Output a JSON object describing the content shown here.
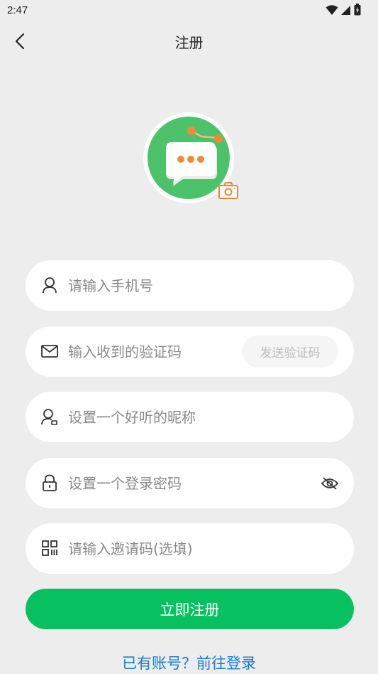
{
  "status_bar": {
    "time": "2:47"
  },
  "header": {
    "title": "注册"
  },
  "form": {
    "phone_placeholder": "请输入手机号",
    "code_placeholder": "输入收到的验证码",
    "send_code_label": "发送验证码",
    "nickname_placeholder": "设置一个好听的昵称",
    "password_placeholder": "设置一个登录密码",
    "invite_placeholder": "请输入邀请码(选填)",
    "submit_label": "立即注册"
  },
  "footer": {
    "login_link": "已有账号？前往登录"
  },
  "colors": {
    "accent": "#07c160",
    "link": "#1a7bd6",
    "background": "#ededed",
    "camera_badge": "#e8853a"
  },
  "icons": {
    "back": "chevron-left-icon",
    "phone": "user-icon",
    "code": "mail-icon",
    "nickname": "user-card-icon",
    "password": "lock-icon",
    "eye": "eye-off-icon",
    "invite": "qr-code-icon",
    "camera": "camera-icon"
  }
}
